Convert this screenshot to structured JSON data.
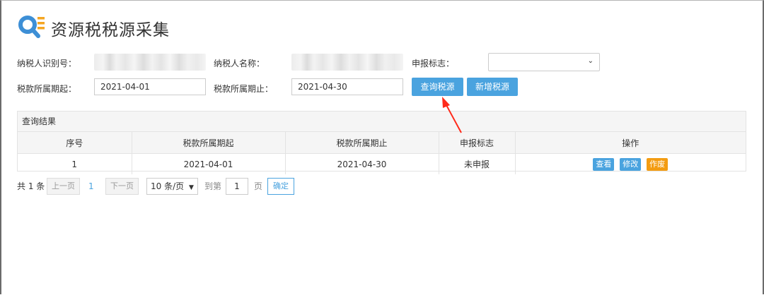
{
  "header": {
    "title": "资源税税源采集"
  },
  "form": {
    "taxpayer_id_label": "纳税人识别号：",
    "taxpayer_name_label": "纳税人名称：",
    "declare_flag_label": "申报标志：",
    "period_start_label": "税款所属期起：",
    "period_start_value": "2021-04-01",
    "period_end_label": "税款所属期止：",
    "period_end_value": "2021-04-30",
    "query_button": "查询税源",
    "add_button": "新增税源"
  },
  "results": {
    "title": "查询结果",
    "columns": [
      "序号",
      "税款所属期起",
      "税款所属期止",
      "申报标志",
      "操作"
    ],
    "rows": [
      {
        "index": "1",
        "start": "2021-04-01",
        "end": "2021-04-30",
        "status": "未申报",
        "actions": [
          "查看",
          "修改",
          "作废"
        ]
      }
    ]
  },
  "pager": {
    "total": "共 1 条",
    "prev": "上一页",
    "current": "1",
    "next": "下一页",
    "page_size": "10 条/页",
    "goto_label": "到第",
    "goto_value": "1",
    "page_unit": "页",
    "confirm": "确定"
  },
  "colors": {
    "primary": "#4aa3df",
    "warning": "#f39c12",
    "annotation": "#ff2a1a"
  }
}
